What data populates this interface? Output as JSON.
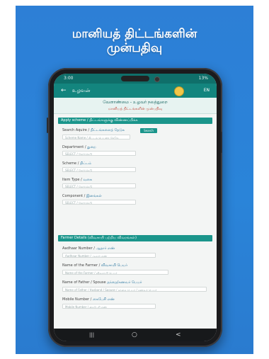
{
  "banner": {
    "headline_line1": "மானியத் திட்டங்களின்",
    "headline_line2": "முன்பதிவு"
  },
  "status": {
    "time": "3:00",
    "battery": "13%"
  },
  "appbar": {
    "back_glyph": "←",
    "title": "உழவன்",
    "lang": "EN"
  },
  "department": {
    "name": "வேளாண்மை - உழவர் நலத்துறை",
    "subtitle": "மானியத் திட்டங்களின் முன்பதிவு"
  },
  "scheme_section": {
    "header": "Apply scheme / திட்டங்களுக்கு விண்ணப்பிக்க",
    "search": {
      "label_en": "Search Aquire /",
      "label_ta": "திட்டங்களைத் தேடுக",
      "placeholder": "Scheme Name / திட்டம் பெயரை தேடுக",
      "button": "Search"
    },
    "department": {
      "label_en": "Department /",
      "label_ta": "துறை",
      "value": "SELECT / தேர்ந்தெடு"
    },
    "scheme": {
      "label_en": "Scheme /",
      "label_ta": "திட்டம்",
      "value": "SELECT / தேர்ந்தெடு"
    },
    "item_type": {
      "label_en": "Item Type /",
      "label_ta": "வகை",
      "value": "SELECT / தேர்ந்தெடு"
    },
    "component": {
      "label_en": "Component /",
      "label_ta": "இனங்கள்",
      "value": "SELECT / தேர்ந்தெடு"
    }
  },
  "farmer_section": {
    "header": "Farmer Details (விவசாயி பற்றிய விவரங்கள்)",
    "aadhaar": {
      "label_en": "Aadhaar Number /",
      "label_ta": "ஆதார் எண்",
      "placeholder": "Aadhaar Number / ஆதார் எண்"
    },
    "farmer_name": {
      "label_en": "Name of the Farmer /",
      "label_ta": "விவசாயி பெயர்",
      "placeholder": "Name of the Farmer / விவசாயி பெயர்"
    },
    "father_name": {
      "label_en": "Name of Father / Spouse",
      "label_ta": "தந்தை/கணவர் பெயர்",
      "placeholder": "Name of Father / Husband / Spouse / தந்தை பெயர் / கணவர் பெயர்"
    },
    "mobile": {
      "label_en": "Mobile Number /",
      "label_ta": "கைபேசி எண்",
      "placeholder": "Mobile Number / கைபேசி எண்"
    }
  },
  "navbar": {
    "recents": "|||",
    "home": "○",
    "back": "<"
  },
  "colors": {
    "banner": "#2a84d9",
    "app_teal": "#13857e",
    "section_teal": "#1a958b",
    "accent_red": "#c0392b"
  }
}
